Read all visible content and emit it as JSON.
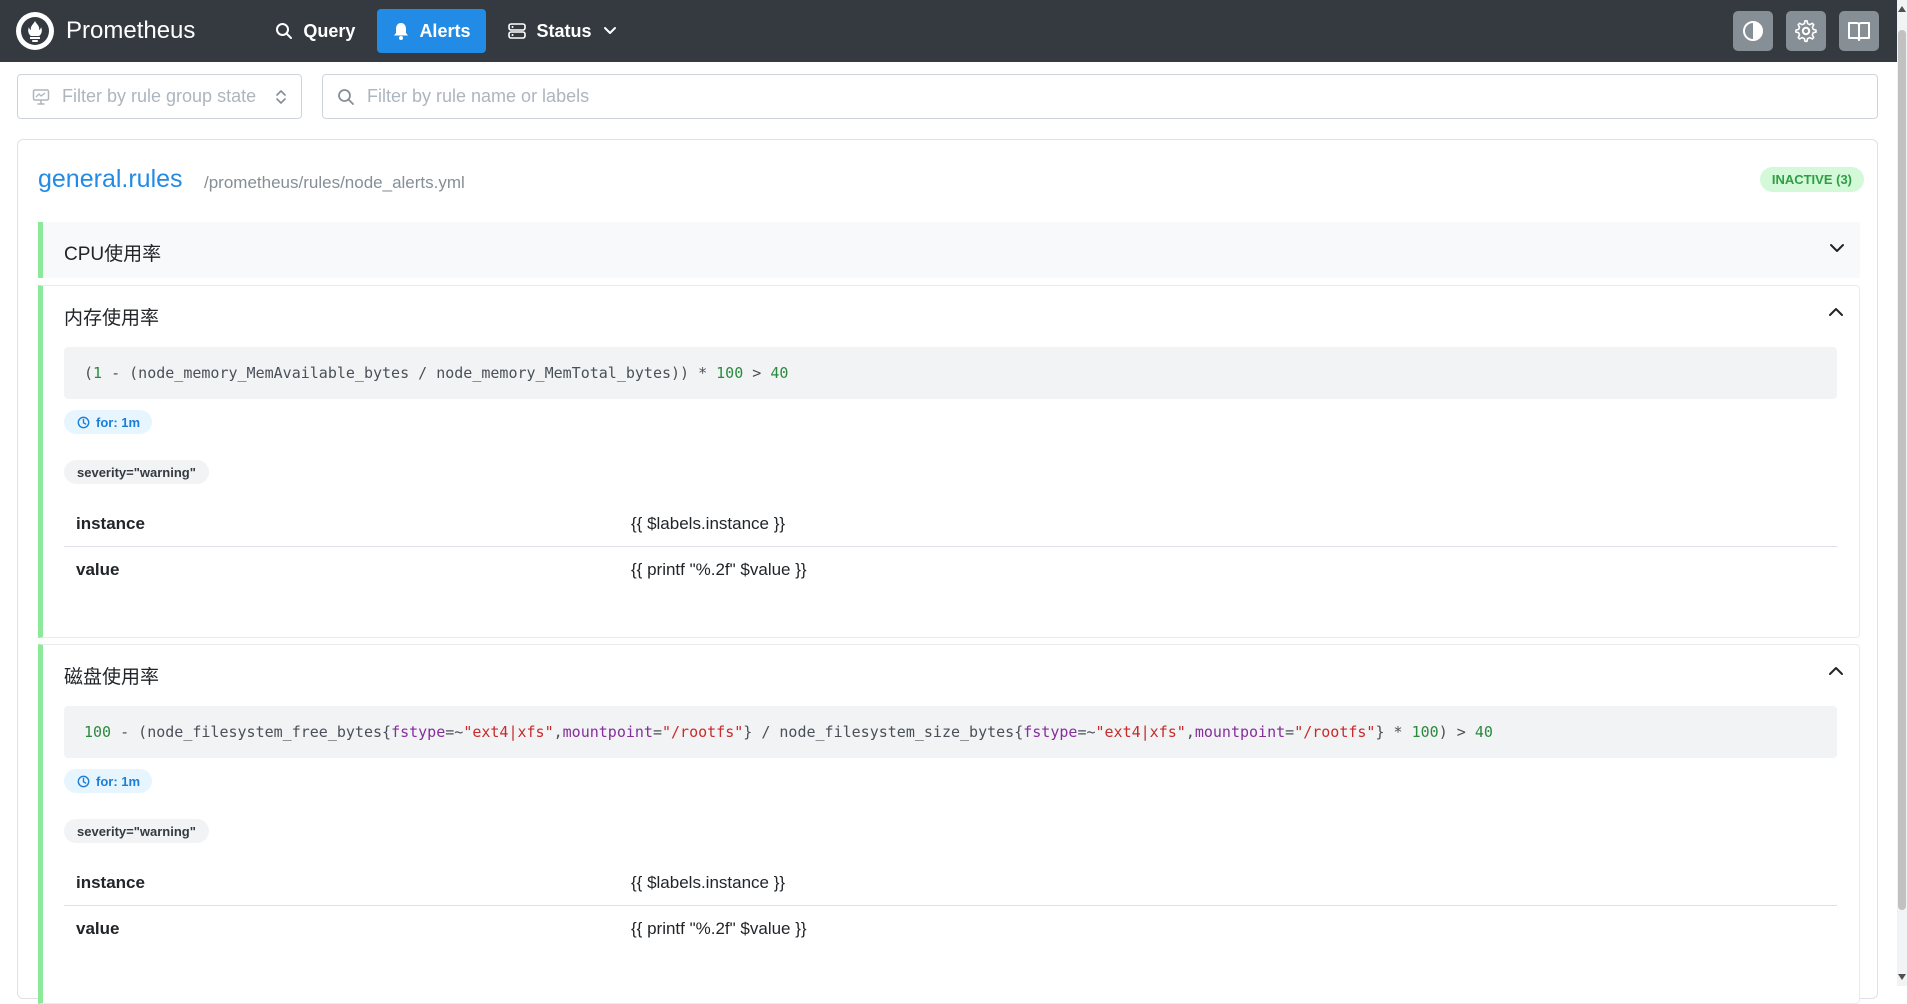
{
  "header": {
    "brand": "Prometheus",
    "nav": [
      {
        "label": "Query",
        "icon": "search-icon"
      },
      {
        "label": "Alerts",
        "icon": "bell-icon",
        "active": true
      },
      {
        "label": "Status",
        "icon": "server-icon"
      }
    ],
    "actions": [
      "theme-toggle-icon",
      "gear-icon",
      "book-icon"
    ]
  },
  "filters": {
    "state_placeholder": "Filter by rule group state",
    "search_placeholder": "Filter by rule name or labels"
  },
  "group": {
    "name": "general.rules",
    "file": "/prometheus/rules/node_alerts.yml",
    "state_badge": "INACTIVE (3)",
    "rules": [
      {
        "name": "CPU使用率",
        "expanded": false
      },
      {
        "name": "内存使用率",
        "expanded": true,
        "for": "for: 1m",
        "labels": [
          "severity=\"warning\""
        ],
        "annotations": [
          {
            "key": "instance",
            "value": "{{ $labels.instance }}"
          },
          {
            "key": "value",
            "value": "{{ printf \"%.2f\" $value }}"
          }
        ]
      },
      {
        "name": "磁盘使用率",
        "expanded": true,
        "for": "for: 1m",
        "labels": [
          "severity=\"warning\""
        ],
        "annotations": [
          {
            "key": "instance",
            "value": "{{ $labels.instance }}"
          },
          {
            "key": "value",
            "value": "{{ printf \"%.2f\" $value }}"
          }
        ]
      }
    ]
  },
  "expr_tokens": {
    "mem": {
      "p0": "(",
      "n0": "1",
      "p1": " - (node_memory_MemAvailable_bytes / node_memory_MemTotal_bytes)) * ",
      "n1": "100",
      "p2": " > ",
      "n2": "40"
    },
    "disk": {
      "n0": "100",
      "p0": " - (node_filesystem_free_bytes{",
      "l0": "fstype",
      "p1": "=~",
      "s0": "\"ext4|xfs\"",
      "p2": ",",
      "l1": "mountpoint",
      "p3": "=",
      "s1": "\"/rootfs\"",
      "p4": "} / node_filesystem_size_bytes{",
      "l2": "fstype",
      "p5": "=~",
      "s2": "\"ext4|xfs\"",
      "p6": ",",
      "l3": "mountpoint",
      "p7": "=",
      "s3": "\"/rootfs\"",
      "p8": "} * ",
      "n1": "100",
      "p9": ") > ",
      "n2": "40"
    }
  },
  "colors": {
    "header_bg": "#343a40",
    "accent": "#228be6",
    "rule_border": "#8ce99a",
    "inactive_badge_bg": "#d3f9d8",
    "inactive_badge_text": "#2f9e44"
  }
}
